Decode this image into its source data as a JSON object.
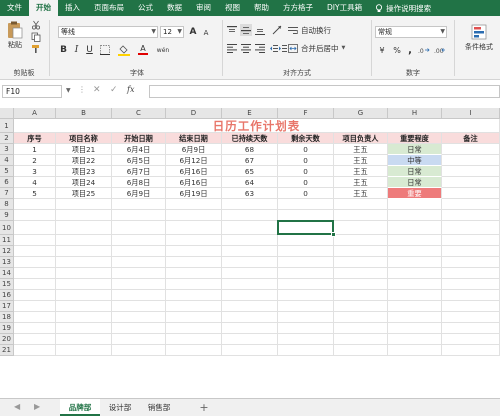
{
  "ribbon_tabs": [
    "文件",
    "开始",
    "插入",
    "页面布局",
    "公式",
    "数据",
    "审阅",
    "视图",
    "帮助",
    "方方格子",
    "DIY工具箱"
  ],
  "help_search": "操作说明搜索",
  "clipboard": {
    "paste": "粘贴",
    "label": "剪贴板"
  },
  "font": {
    "name": "等线",
    "size": "12",
    "bold": "B",
    "italic": "I",
    "underline": "U",
    "grow": "A",
    "shrink": "A",
    "color_a": "A",
    "wen": "wén",
    "label": "字体"
  },
  "alignment": {
    "wrap": "自动换行",
    "merge": "合并后居中",
    "label": "对齐方式"
  },
  "number": {
    "format": "常规",
    "currency": "¥",
    "percent": "%",
    "comma": ",",
    "label": "数字"
  },
  "styles": {
    "cond": "条件格式"
  },
  "namebox": "F10",
  "fx": "fx",
  "columns": [
    "A",
    "B",
    "C",
    "D",
    "E",
    "F",
    "G",
    "H",
    "I"
  ],
  "rows": [
    "1",
    "2",
    "3",
    "4",
    "5",
    "6",
    "7",
    "8",
    "9",
    "10",
    "11",
    "12",
    "13",
    "14",
    "15",
    "16",
    "17",
    "18",
    "19",
    "20",
    "21"
  ],
  "sheet": {
    "title": "日历工作计划表",
    "headers": [
      "序号",
      "项目名称",
      "开始日期",
      "结束日期",
      "已持续天数",
      "剩余天数",
      "项目负责人",
      "重要程度",
      "备注"
    ],
    "records": [
      [
        "1",
        "项目21",
        "6月4日",
        "6月9日",
        "68",
        "0",
        "王五",
        "日常",
        ""
      ],
      [
        "2",
        "项目22",
        "6月5日",
        "6月12日",
        "67",
        "0",
        "王五",
        "中等",
        ""
      ],
      [
        "3",
        "项目23",
        "6月7日",
        "6月16日",
        "65",
        "0",
        "王五",
        "日常",
        ""
      ],
      [
        "4",
        "项目24",
        "6月8日",
        "6月16日",
        "64",
        "0",
        "王五",
        "日常",
        ""
      ],
      [
        "5",
        "项目25",
        "6月9日",
        "6月19日",
        "63",
        "0",
        "王五",
        "重要",
        ""
      ]
    ]
  },
  "importance_colors": {
    "日常": "#d8ead2",
    "中等": "#c9daf1",
    "重要": "#ee7b7b"
  },
  "colors": {
    "accent": "#217346",
    "title": "#e8766a",
    "band": "#f9dcdc"
  },
  "sheet_tabs": [
    "品牌部",
    "设计部",
    "销售部"
  ],
  "add_sheet": "+"
}
